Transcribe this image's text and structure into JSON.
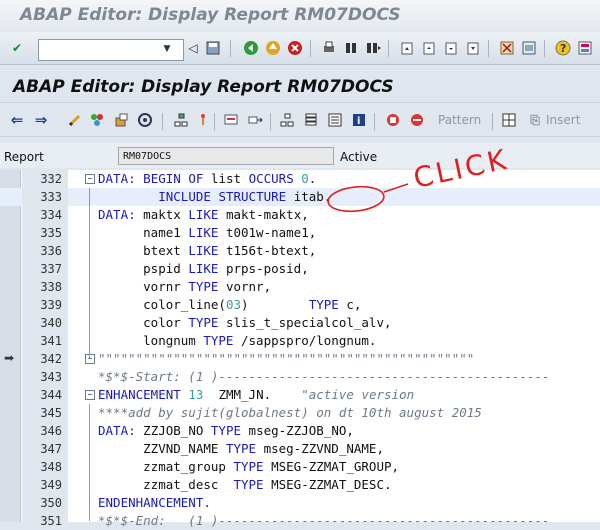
{
  "window": {
    "title": "ABAP Editor: Display Report RM07DOCS"
  },
  "screen_title": "ABAP Editor: Display Report RM07DOCS",
  "command_field": {
    "value": ""
  },
  "app_toolbar": {
    "pattern_label": "Pattern",
    "insert_label": "Insert"
  },
  "report": {
    "label": "Report",
    "value": "RM07DOCS",
    "status": "Active"
  },
  "annotation": {
    "text": "CLICK",
    "color": "#e02020"
  },
  "code_lines": [
    {
      "no": "332",
      "code": "DATA: BEGIN OF list OCCURS 0."
    },
    {
      "no": "333",
      "code": "        INCLUDE STRUCTURE itab."
    },
    {
      "no": "334",
      "code": "DATA: maktx LIKE makt-maktx,"
    },
    {
      "no": "335",
      "code": "      name1 LIKE t001w-name1,"
    },
    {
      "no": "336",
      "code": "      btext LIKE t156t-btext,"
    },
    {
      "no": "337",
      "code": "      pspid LIKE prps-posid,"
    },
    {
      "no": "338",
      "code": "      vornr TYPE vornr,"
    },
    {
      "no": "339",
      "code": "      color_line(03)        TYPE c,"
    },
    {
      "no": "340",
      "code": "      color TYPE slis_t_specialcol_alv,"
    },
    {
      "no": "341",
      "code": "      longnum TYPE /sappspro/longnum."
    },
    {
      "no": "342",
      "code": "\"\"\"\"\"\"\"\"\"\"\"\"\"\"\"\"\"\"\"\"\"\"\"\"\"\"\"\"\"\"\"\"\"\"\"\"\"\"\"\"\"\"\"\"\"\"\"\"\"\""
    },
    {
      "no": "343",
      "code": "*$*$-Start: (1 )--------------------------------------------"
    },
    {
      "no": "344",
      "code": "ENHANCEMENT 13  ZMM_JN.    \"active version"
    },
    {
      "no": "345",
      "code": "****add by sujit(globalnest) on dt 10th august 2015"
    },
    {
      "no": "346",
      "code": "DATA: ZZJOB_NO TYPE mseg-ZZJOB_NO,"
    },
    {
      "no": "347",
      "code": "      ZZVND_NAME TYPE mseg-ZZVND_NAME,"
    },
    {
      "no": "348",
      "code": "      zzmat_group TYPE MSEG-ZZMAT_GROUP,"
    },
    {
      "no": "349",
      "code": "      zzmat_desc  TYPE MSEG-ZZMAT_DESC."
    },
    {
      "no": "350",
      "code": "ENDENHANCEMENT."
    },
    {
      "no": "351",
      "code": "*$*$-End:   (1 )--------------------------------------------"
    }
  ]
}
